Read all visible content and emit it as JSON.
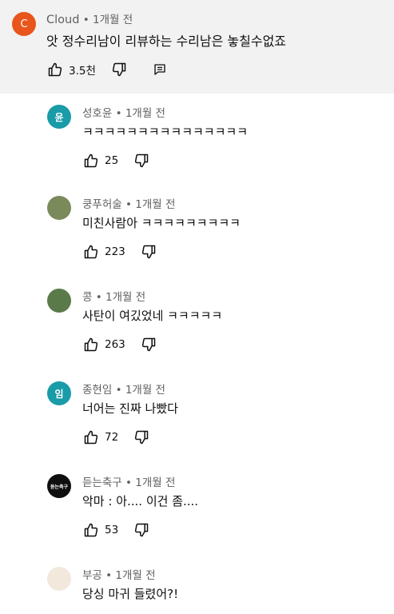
{
  "parent": {
    "avatar_letter": "C",
    "avatar_color": "#e8561c",
    "author": "Cloud",
    "sep": "•",
    "time": "1개월 전",
    "text": "앗 정수리남이 리뷰하는 수리남은 놓칠수없죠",
    "likes": "3.5천"
  },
  "replies": [
    {
      "author": "성호윤",
      "time": "1개월 전",
      "text": "ㅋㅋㅋㅋㅋㅋㅋㅋㅋㅋㅋㅋㅋㅋㅋ",
      "likes": "25",
      "avatar_letter": "윤",
      "avatar_color": "#1a9ba8"
    },
    {
      "author": "쿵푸허술",
      "time": "1개월 전",
      "text": "미친사람아 ㅋㅋㅋㅋㅋㅋㅋㅋㅋ",
      "likes": "223",
      "avatar_letter": "",
      "avatar_color": "#7a8a5a"
    },
    {
      "author": "콩",
      "time": "1개월 전",
      "text": "사탄이 여깄었네 ㅋㅋㅋㅋㅋ",
      "likes": "263",
      "avatar_letter": "",
      "avatar_color": "#5a7a4a"
    },
    {
      "author": "종현임",
      "time": "1개월 전",
      "text": "너어는 진짜 나빴다",
      "likes": "72",
      "avatar_letter": "임",
      "avatar_color": "#1a9ba8"
    },
    {
      "author": "듣는축구",
      "time": "1개월 전",
      "text": "악마 : 아.... 이건 좀....",
      "likes": "53",
      "avatar_letter": "듣는축구",
      "avatar_color": "#0f0f0f"
    },
    {
      "author": "부공",
      "time": "1개월 전",
      "text": "당싱 마귀 들렸어?!",
      "likes": "",
      "avatar_letter": "",
      "avatar_color": "#f2e8dc"
    }
  ],
  "icons": {
    "like": "thumbs-up-icon",
    "dislike": "thumbs-down-icon",
    "reply": "reply-comment-icon"
  }
}
